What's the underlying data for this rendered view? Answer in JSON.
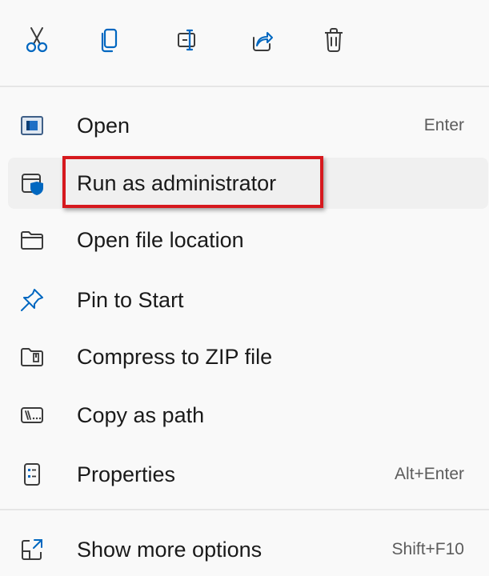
{
  "toolbar": {
    "buttons": [
      {
        "icon": "scissors-icon",
        "tooltip": "Cut"
      },
      {
        "icon": "copy-icon",
        "tooltip": "Copy"
      },
      {
        "icon": "rename-icon",
        "tooltip": "Rename"
      },
      {
        "icon": "share-icon",
        "tooltip": "Share"
      },
      {
        "icon": "trash-icon",
        "tooltip": "Delete"
      }
    ]
  },
  "menu": {
    "items": [
      {
        "label": "Open",
        "shortcut": "Enter",
        "icon": "app-window-icon"
      },
      {
        "label": "Run as administrator",
        "shortcut": "",
        "icon": "shield-window-icon",
        "highlighted": true
      },
      {
        "label": "Open file location",
        "shortcut": "",
        "icon": "folder-icon"
      },
      {
        "label": "Pin to Start",
        "shortcut": "",
        "icon": "pin-icon"
      },
      {
        "label": "Compress to ZIP file",
        "shortcut": "",
        "icon": "zip-folder-icon"
      },
      {
        "label": "Copy as path",
        "shortcut": "",
        "icon": "path-icon"
      },
      {
        "label": "Properties",
        "shortcut": "Alt+Enter",
        "icon": "properties-icon"
      }
    ],
    "footer": {
      "label": "Show more options",
      "shortcut": "Shift+F10",
      "icon": "expand-icon"
    }
  },
  "colors": {
    "accent": "#0067c0",
    "highlight_border": "#d6191e",
    "background": "#f9f9f9",
    "hover": "#f0f0f0"
  }
}
